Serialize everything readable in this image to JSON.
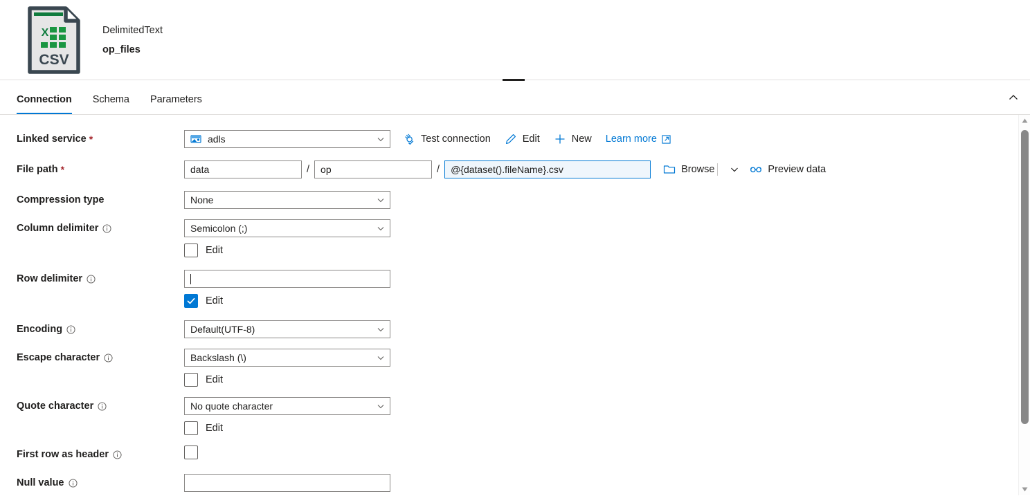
{
  "header": {
    "icon": "csv-file-icon",
    "type_label": "DelimitedText",
    "dataset_name": "op_files"
  },
  "tabs": [
    {
      "label": "Connection",
      "active": true
    },
    {
      "label": "Schema",
      "active": false
    },
    {
      "label": "Parameters",
      "active": false
    }
  ],
  "collapse_icon": "chevron-up-icon",
  "drag_handle": "panel-resize-handle",
  "form": {
    "linked_service": {
      "label": "Linked service",
      "required": "*",
      "value": "adls",
      "icon": "azure-data-lake-storage-icon",
      "actions": [
        {
          "label": "Test connection",
          "icon": "plug-check-icon"
        },
        {
          "label": "Edit",
          "icon": "pencil-icon"
        },
        {
          "label": "New",
          "icon": "plus-icon"
        }
      ],
      "learn_more": {
        "label": "Learn more",
        "icon": "external-link-icon"
      }
    },
    "file_path": {
      "label": "File path",
      "required": "*",
      "container": "data",
      "directory": "op",
      "file_name": "@{dataset().fileName}.csv",
      "separator": "/",
      "browse": {
        "label": "Browse",
        "icon": "folder-icon"
      },
      "browse_chevron": "chevron-down-icon",
      "preview": {
        "label": "Preview data",
        "icon": "glasses-icon"
      }
    },
    "compression_type": {
      "label": "Compression type",
      "value": "None"
    },
    "column_delimiter": {
      "label": "Column delimiter",
      "info": "info-icon",
      "value": "Semicolon (;)",
      "edit_label": "Edit",
      "edit_checked": false
    },
    "row_delimiter": {
      "label": "Row delimiter",
      "info": "info-icon",
      "value": "",
      "edit_label": "Edit",
      "edit_checked": true
    },
    "encoding": {
      "label": "Encoding",
      "info": "info-icon",
      "value": "Default(UTF-8)"
    },
    "escape_character": {
      "label": "Escape character",
      "info": "info-icon",
      "value": "Backslash (\\)",
      "edit_label": "Edit",
      "edit_checked": false
    },
    "quote_character": {
      "label": "Quote character",
      "info": "info-icon",
      "value": "No quote character",
      "edit_label": "Edit",
      "edit_checked": false
    },
    "first_row_as_header": {
      "label": "First row as header",
      "info": "info-icon",
      "checked": false
    },
    "null_value": {
      "label": "Null value",
      "info": "info-icon",
      "value": ""
    }
  },
  "colors": {
    "accent": "#0078d4",
    "required": "#a4262c",
    "border": "#8a8886",
    "text": "#201f1e",
    "csv_green": "#0f7b3d",
    "csv_slate": "#3a4750"
  }
}
